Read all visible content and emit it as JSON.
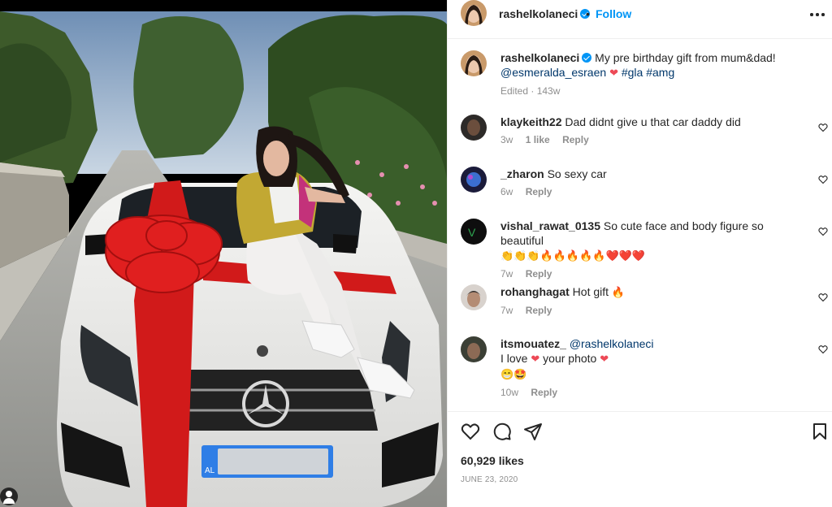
{
  "post": {
    "username": "rashelkolaneci",
    "dot": "•",
    "follow_label": "Follow",
    "caption_text": "My pre birthday gift from mum&dad!",
    "caption_mention": "@esmeralda_esraen",
    "caption_tags": "#gla #amg",
    "edited_label": "Edited · 143w",
    "plate_prefix": "AL",
    "likes": "60,929 likes",
    "date": "June 23, 2020"
  },
  "comments": [
    {
      "username": "klaykeith22",
      "text": "Dad didnt give u that car daddy did",
      "time": "3w",
      "likes": "1 like",
      "reply": "Reply"
    },
    {
      "username": "_zharon",
      "text": "So sexy car",
      "time": "6w",
      "reply": "Reply"
    },
    {
      "username": "vishal_rawat_0135",
      "text": "So cute face and body figure so beautiful",
      "emojis": "👏👏👏🔥🔥🔥🔥🔥❤️❤️❤️",
      "time": "7w",
      "reply": "Reply"
    },
    {
      "username": "rohanghagat",
      "text": "Hot gift",
      "emoji": "🔥",
      "time": "7w",
      "reply": "Reply"
    },
    {
      "username": "itsmouatez_",
      "mention": "@rashelkolaneci",
      "text_a": "I love",
      "text_b": "your photo",
      "emojis": "😁🤩",
      "time": "10w",
      "reply": "Reply"
    }
  ],
  "icons": {
    "verified": "verified-badge-icon",
    "more": "more-options-icon",
    "like": "heart-icon",
    "comment": "comment-icon",
    "share": "paper-plane-icon",
    "save": "bookmark-icon"
  },
  "colors": {
    "accent": "#0095f6",
    "heart": "#ed4956",
    "text": "#262626",
    "muted": "#8e8e8e"
  }
}
